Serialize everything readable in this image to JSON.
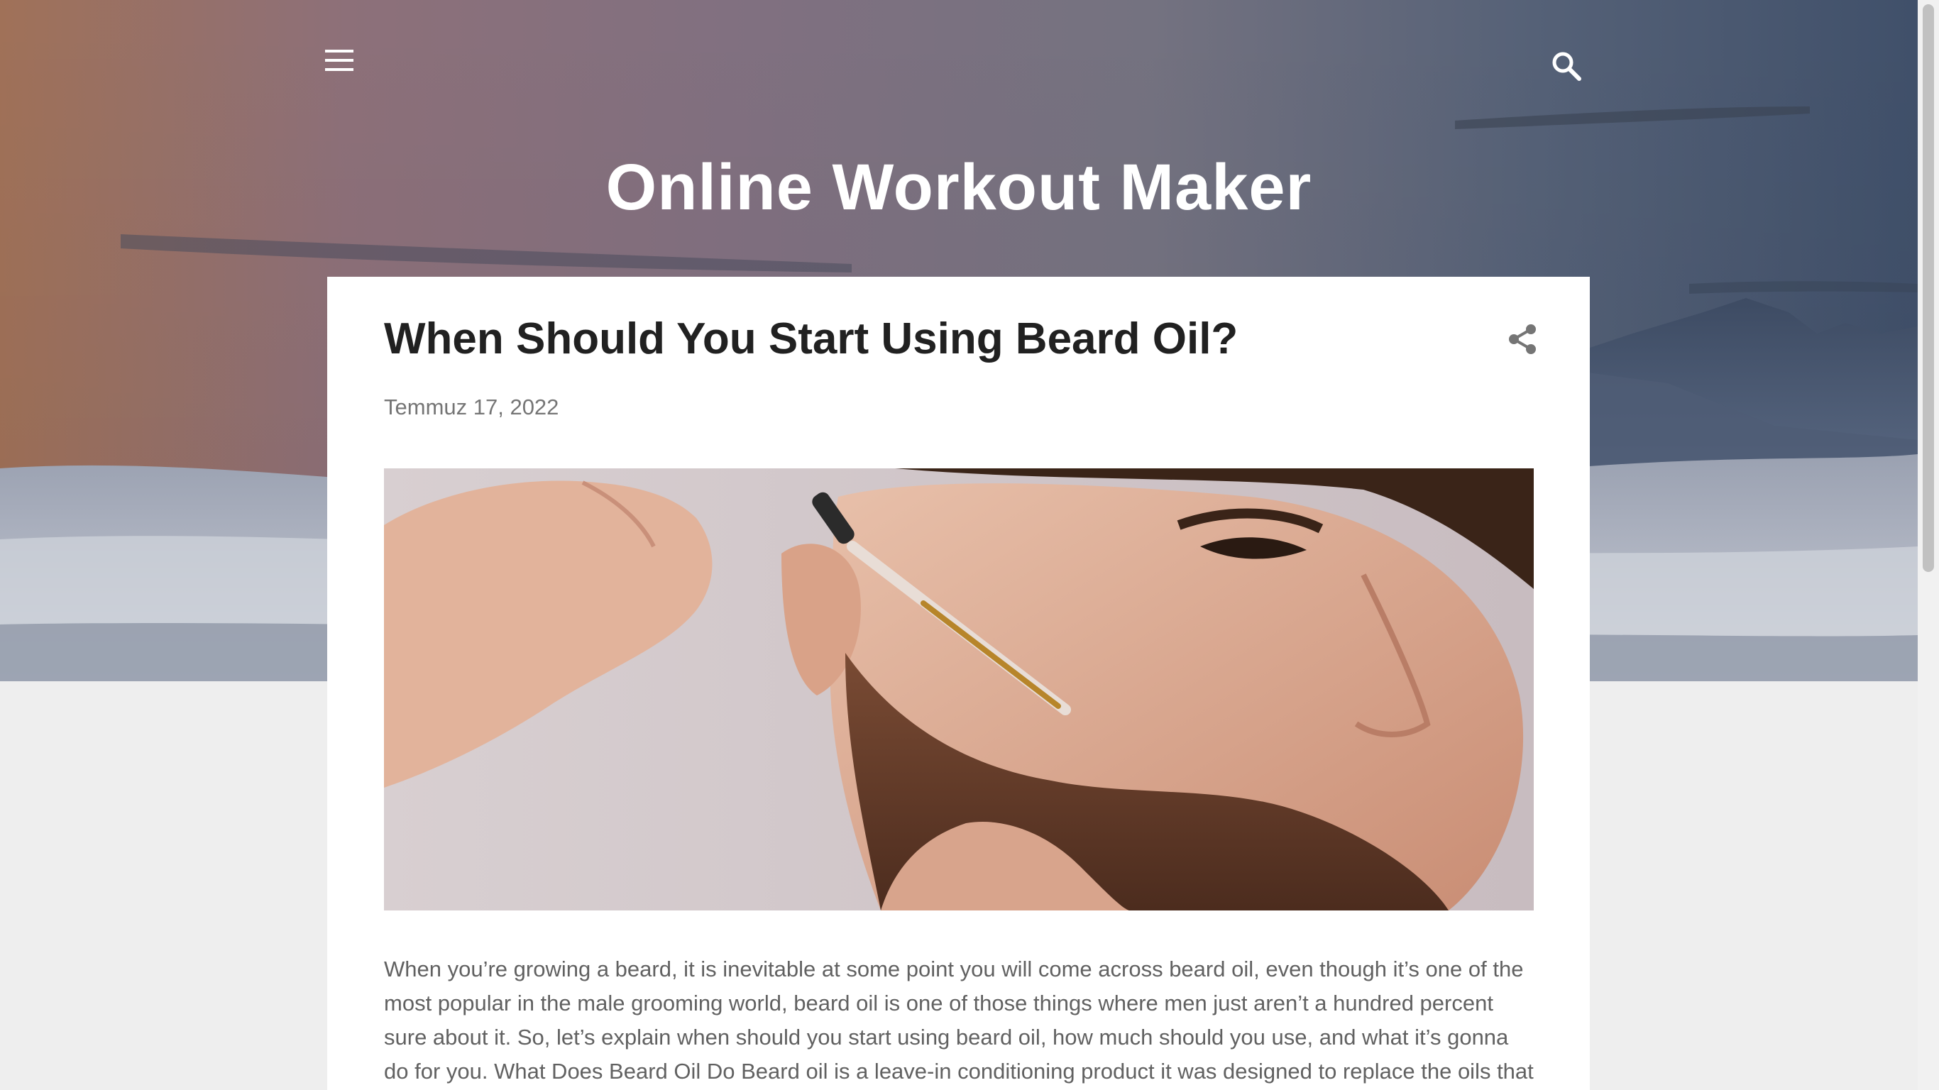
{
  "header": {
    "site_title": "Online Workout Maker",
    "menu_icon": "hamburger-menu-icon",
    "search_icon": "search-icon"
  },
  "post": {
    "title": "When Should You Start Using Beard Oil?",
    "date": "Temmuz 17, 2022",
    "share_icon": "share-icon",
    "body": "When you’re growing a beard, it is inevitable at some point you will come across beard oil, even though it’s one of the most popular in the male grooming world, beard oil is one of those things where men just aren’t a hundred percent sure about it. So, let’s explain when should you start using beard oil, how much should you use, and what it’s gonna do for you. What Does Beard Oil Do Beard oil is a leave-in conditioning product it was designed to replace the oils that you lose after"
  },
  "colors": {
    "page_background": "#eeeeee",
    "card_background": "#ffffff",
    "title_text": "#212121",
    "meta_text": "#757575",
    "body_text": "#616161"
  }
}
